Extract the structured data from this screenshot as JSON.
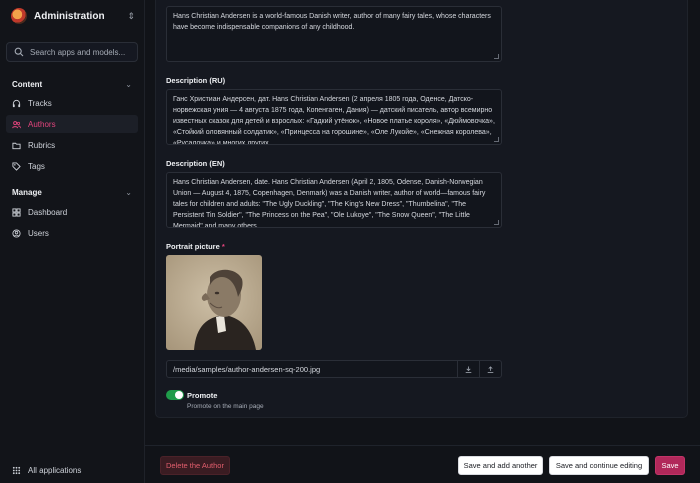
{
  "sidebar": {
    "app_title": "Administration",
    "search_placeholder": "Search apps and models...",
    "sections": [
      {
        "title": "Content",
        "items": [
          {
            "label": "Tracks"
          },
          {
            "label": "Authors"
          },
          {
            "label": "Rubrics"
          },
          {
            "label": "Tags"
          }
        ]
      },
      {
        "title": "Manage",
        "items": [
          {
            "label": "Dashboard"
          },
          {
            "label": "Users"
          }
        ]
      }
    ],
    "active_item": "Authors",
    "all_apps_label": "All applications"
  },
  "form": {
    "short_description": {
      "value": "Hans Christian Andersen is a world-famous Danish writer, author of many fairy tales, whose characters have become indispensable companions of any childhood."
    },
    "description_ru": {
      "label": "Description (RU)",
      "value": "Ганс Христиан Андерсен, дат. Hans Christian Andersen (2 апреля 1805 года, Оденсе, Датско-норвежская уния — 4 августа 1875 года, Копенгаген, Дания) — датский писатель, автор всемирно известных сказок для детей и взрослых: «Гадкий утёнок», «Новое платье короля», «Дюймовочка», «Стойкий оловянный солдатик», «Принцесса на горошине», «Оле Лукойе», «Снежная королева», «Русалочка» и многих других."
    },
    "description_en": {
      "label": "Description (EN)",
      "value": "Hans Christian Andersen, date. Hans Christian Andersen (April 2, 1805, Odense, Danish-Norwegian Union — August 4, 1875, Copenhagen, Denmark) was a Danish writer, author of world—famous fairy tales for children and adults: \"The Ugly Duckling\", \"The King's New Dress\", \"Thumbelina\", \"The Persistent Tin Soldier\", \"The Princess on the Pea\", \"Ole Lukoye\", \"The Snow Queen\", \"The Little Mermaid\" and many others."
    },
    "portrait": {
      "label": "Portrait picture",
      "required_mark": "*",
      "file_path": "/media/samples/author-andersen-sq-200.jpg"
    },
    "promote": {
      "label": "Promote",
      "help": "Promote on the main page",
      "checked": true
    }
  },
  "footer": {
    "delete_label": "Delete the Author",
    "save_add_another_label": "Save and add another",
    "save_continue_label": "Save and continue editing",
    "save_label": "Save"
  },
  "colors": {
    "accent": "#b1285a",
    "active_nav_text": "#e3447d",
    "toggle_on": "#1f9c4a",
    "danger": "#e25e6d"
  }
}
